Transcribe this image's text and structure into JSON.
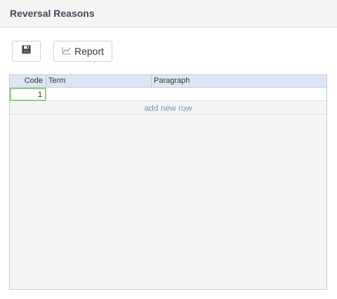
{
  "header": {
    "title": "Reversal Reasons"
  },
  "toolbar": {
    "save_icon": "floppy-disk-icon",
    "report_label": "Report",
    "report_icon": "line-chart-icon"
  },
  "grid": {
    "columns": [
      "Code",
      "Term",
      "Paragraph"
    ],
    "rows": [
      {
        "code": "1",
        "term": "",
        "paragraph": ""
      }
    ],
    "add_row_label": "add new row"
  },
  "colors": {
    "header_bg": "#f5f5f5",
    "grid_header_bg": "#dbe6f5",
    "selected_cell_border": "#8fcf7b",
    "link": "#7f95b8"
  }
}
